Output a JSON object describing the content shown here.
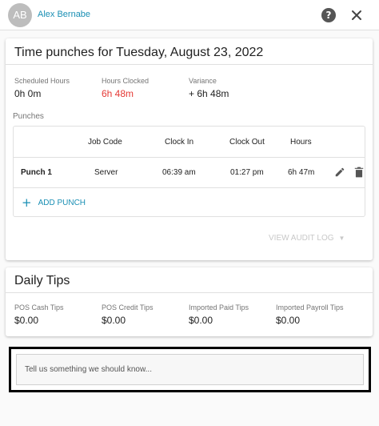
{
  "header": {
    "avatar_initials": "AB",
    "user_name": "Alex Bernabe",
    "help_icon": "help-circle-icon",
    "close_icon": "close-icon"
  },
  "time_punches": {
    "title": "Time punches for Tuesday, August 23, 2022",
    "stats": [
      {
        "label": "Scheduled Hours",
        "value": "0h 0m"
      },
      {
        "label": "Hours Clocked",
        "value": "6h 48m",
        "color": "#e53935"
      },
      {
        "label": "Variance",
        "value": "+ 6h 48m"
      }
    ],
    "punches_label": "Punches",
    "table": {
      "headers": [
        "Job Code",
        "Clock In",
        "Clock Out",
        "Hours"
      ],
      "rows": [
        {
          "name": "Punch 1",
          "job_code": "Server",
          "clock_in": "06:39 am",
          "clock_out": "01:27 pm",
          "hours": "6h 47m"
        }
      ],
      "row_icons": [
        "edit-pencil-icon",
        "delete-trash-icon"
      ]
    },
    "add_punch_label": "ADD PUNCH",
    "audit_log_label": "VIEW AUDIT LOG"
  },
  "daily_tips": {
    "title": "Daily Tips",
    "tips": [
      {
        "label": "POS Cash Tips",
        "value": "$0.00"
      },
      {
        "label": "POS Credit Tips",
        "value": "$0.00"
      },
      {
        "label": "Imported Paid Tips",
        "value": "$0.00"
      },
      {
        "label": "Imported Payroll Tips",
        "value": "$0.00"
      }
    ]
  },
  "feedback": {
    "placeholder": "Tell us something we should know..."
  },
  "colors": {
    "accent": "#1a8fb4",
    "hours_clocked": "#e53935",
    "highlight_border": "#000000"
  }
}
